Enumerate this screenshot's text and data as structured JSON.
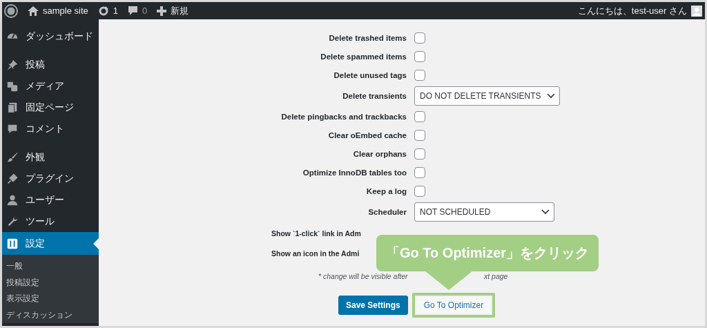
{
  "admin_bar": {
    "site_name": "sample site",
    "updates": "1",
    "comments": "0",
    "new": "新規",
    "greeting": "こんにちは、test-user さん"
  },
  "sidebar": {
    "groups": [
      [
        {
          "label": "ダッシュボード",
          "selected": false
        }
      ],
      [
        {
          "label": "投稿",
          "selected": false
        },
        {
          "label": "メディア",
          "selected": false
        },
        {
          "label": "固定ページ",
          "selected": false
        },
        {
          "label": "コメント",
          "selected": false
        }
      ],
      [
        {
          "label": "外観",
          "selected": false
        },
        {
          "label": "プラグイン",
          "selected": false
        },
        {
          "label": "ユーザー",
          "selected": false
        },
        {
          "label": "ツール",
          "selected": false
        },
        {
          "label": "設定",
          "selected": true
        }
      ]
    ],
    "submenu": [
      "一般",
      "投稿設定",
      "表示設定",
      "ディスカッション"
    ]
  },
  "settings": [
    {
      "label": "Delete trashed items",
      "kind": "checkbox",
      "checked": false
    },
    {
      "label": "Delete spammed items",
      "kind": "checkbox",
      "checked": false
    },
    {
      "label": "Delete unused tags",
      "kind": "checkbox",
      "checked": false
    },
    {
      "label": "Delete transients",
      "kind": "select",
      "value": "DO NOT DELETE TRANSIENTS"
    },
    {
      "label": "Delete pingbacks and trackbacks",
      "kind": "checkbox",
      "checked": false
    },
    {
      "label": "Clear oEmbed cache",
      "kind": "checkbox",
      "checked": false
    },
    {
      "label": "Clear orphans",
      "kind": "checkbox",
      "checked": false
    },
    {
      "label": "Optimize InnoDB tables too",
      "kind": "checkbox",
      "checked": false
    },
    {
      "label": "Keep a log",
      "kind": "checkbox",
      "checked": false
    },
    {
      "label": "Scheduler",
      "kind": "select",
      "value": "NOT SCHEDULED"
    },
    {
      "label": "Show `1-click` link in Adm",
      "kind": "covered"
    },
    {
      "label": "Show an icon in the Admi",
      "kind": "covered"
    }
  ],
  "note": [
    "* change will be visible after",
    "xt page"
  ],
  "buttons": {
    "save": "Save Settings",
    "optimizer": "Go To Optimizer"
  },
  "callout": {
    "text": "「Go To Optimizer」をクリック"
  }
}
